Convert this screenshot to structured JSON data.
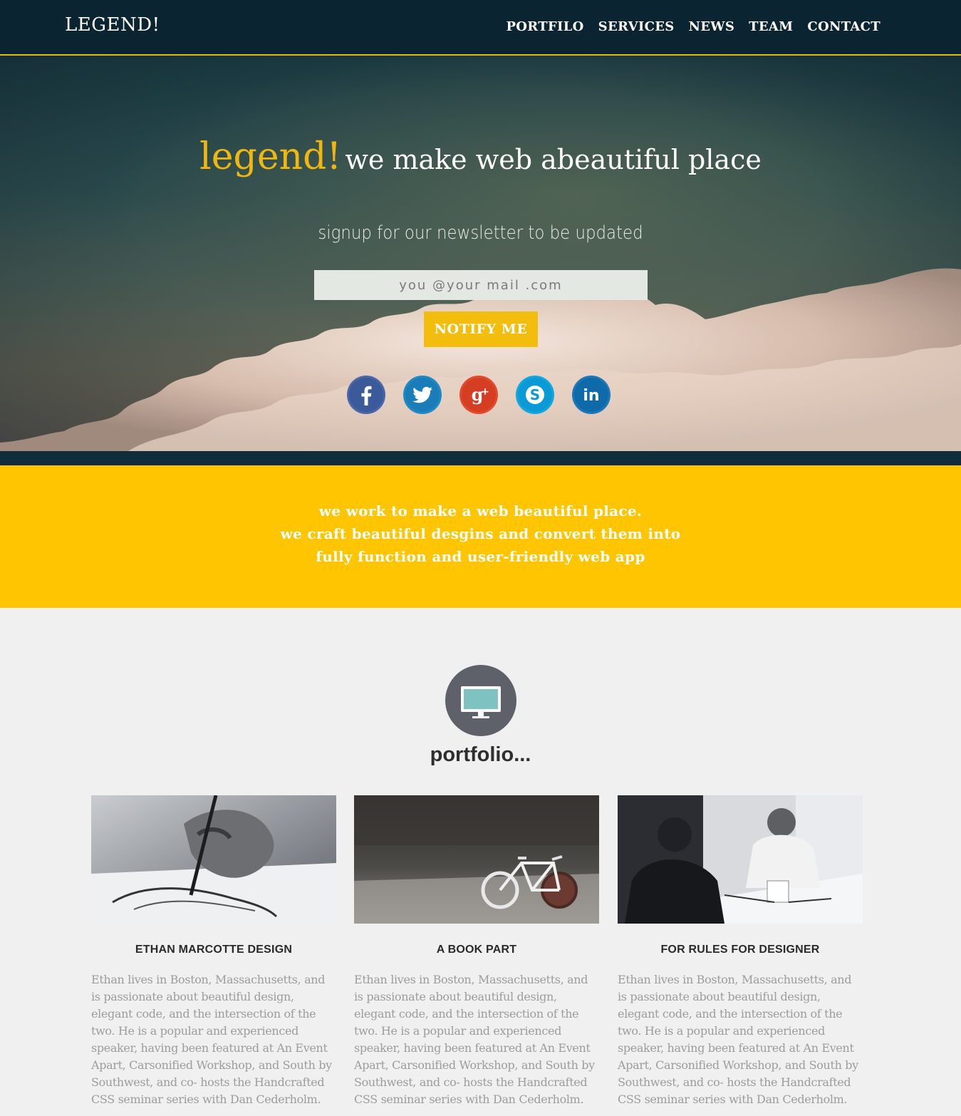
{
  "nav": {
    "logo": "LEGEND!",
    "items": [
      "PORTFILO",
      "SERVICES",
      "NEWS",
      "TEAM",
      "CONTACT"
    ]
  },
  "hero": {
    "brand": "legend!",
    "tagline": "we make web abeautiful place",
    "signup_text": "signup for our newsletter to be updated",
    "email_placeholder": "you @your mail .com",
    "button_label": "NOTIFY ME",
    "social": [
      "facebook-icon",
      "twitter-icon",
      "google-plus-icon",
      "skype-icon",
      "linkedin-icon"
    ]
  },
  "mission": {
    "lines": [
      "we work to make a web beautiful place.",
      "we craft beautiful desgins and convert them into",
      "fully function and user-friendly web app"
    ]
  },
  "portfolio": {
    "icon": "monitor-icon",
    "title": "portfolio...",
    "cards": [
      {
        "title": "ETHAN MARCOTTE DESIGN",
        "text": "Ethan lives in Boston, Massachusetts, and is passionate about beautiful design, elegant code, and the intersection of the two. He is a popular and experienced speaker, having been featured at An Event Apart, Carsonified Workshop, and South by Southwest, and co- hosts the Handcrafted CSS seminar series with Dan Cederholm."
      },
      {
        "title": "A BOOK PART",
        "text": "Ethan lives in Boston, Massachusetts, and is passionate about beautiful design, elegant code, and the intersection of the two. He is a popular and experienced speaker, having been featured at An Event Apart, Carsonified Workshop, and South by Southwest, and co- hosts the Handcrafted CSS seminar series with Dan Cederholm."
      },
      {
        "title": "FOR RULES FOR DESIGNER",
        "text": "Ethan lives in Boston, Massachusetts, and is passionate about beautiful design, elegant code, and the intersection of the two. He is a popular and experienced speaker, having been featured at An Event Apart, Carsonified Workshop, and South by Southwest, and co- hosts the Handcrafted CSS seminar series with Dan Cederholm."
      }
    ]
  },
  "colors": {
    "nav_bg": "#0a2431",
    "accent_yellow": "#fec500",
    "brand_gold": "#f0b80f"
  }
}
